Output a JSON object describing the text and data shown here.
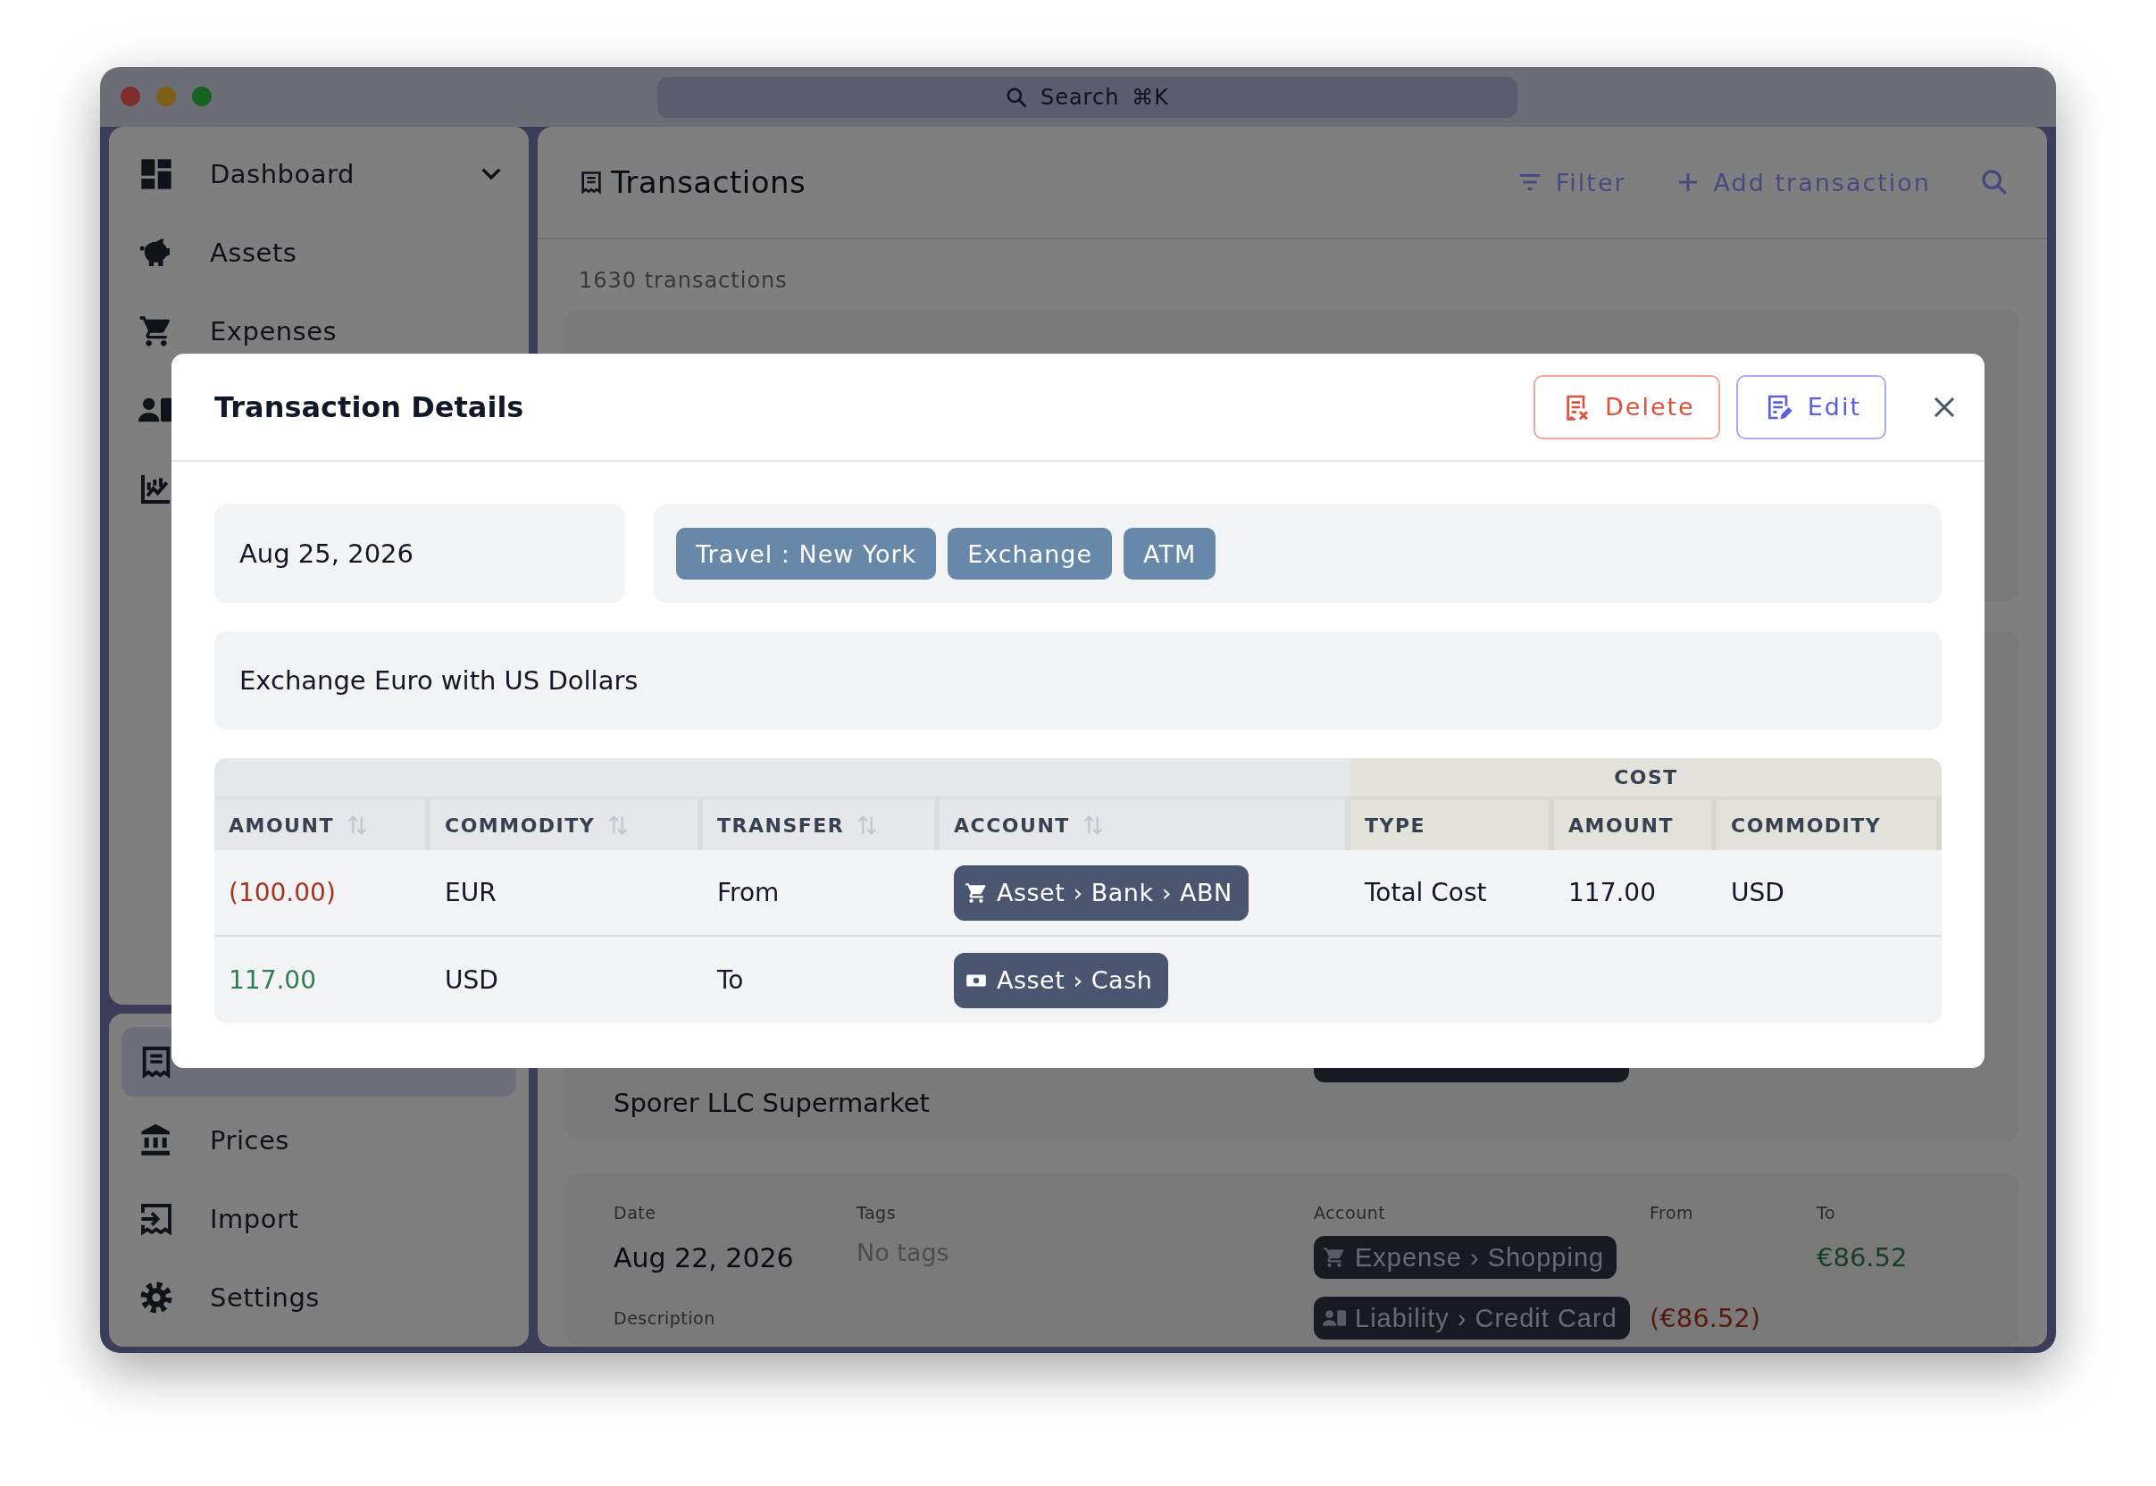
{
  "window": {
    "search": {
      "placeholder": "Search",
      "shortcut": "⌘K"
    }
  },
  "sidebar": {
    "top_items": [
      {
        "label": "Dashboard",
        "selected": false,
        "expandable": true
      },
      {
        "label": "Assets",
        "selected": false
      },
      {
        "label": "Expenses",
        "selected": false
      },
      {
        "selected": false
      },
      {
        "selected": false
      }
    ],
    "bottom_items": [
      {
        "selected": true
      },
      {
        "label": "Prices",
        "selected": false
      },
      {
        "label": "Import",
        "selected": false
      },
      {
        "label": "Settings",
        "selected": false
      }
    ]
  },
  "main": {
    "title": "Transactions",
    "actions": [
      {
        "label": "Filter",
        "kind": "filter"
      },
      {
        "label": "Add transaction",
        "kind": "add"
      }
    ],
    "count": "1630 transactions",
    "card_2": {
      "description": "Sporer LLC Supermarket"
    },
    "card_3": {
      "date_label": "Date",
      "tags_label": "Tags",
      "account_label": "Account",
      "from_label": "From",
      "to_label": "To",
      "description_label": "Description",
      "date": "Aug 22, 2026",
      "tags": "No tags",
      "splits": [
        {
          "kind": "expense",
          "account": "Expense › Shopping",
          "to": "€86.52"
        },
        {
          "kind": "liability",
          "account": "Liability › Credit Card",
          "from": "(€86.52)"
        }
      ]
    }
  },
  "dialog": {
    "title": "Transaction Details",
    "buttons": [
      {
        "label": "Delete",
        "kind": "delete"
      },
      {
        "label": "Edit",
        "kind": "edit"
      }
    ],
    "date": "Aug 25, 2026",
    "tags": [
      {
        "label": "Travel : New York"
      },
      {
        "label": "Exchange"
      },
      {
        "label": "ATM"
      }
    ],
    "description": "Exchange Euro with US Dollars",
    "table": {
      "cost_group": "COST",
      "columns": [
        {
          "label": "AMOUNT",
          "sortable": true,
          "in_cost": false
        },
        {
          "label": "COMMODITY",
          "sortable": true,
          "in_cost": false
        },
        {
          "label": "TRANSFER",
          "sortable": true,
          "in_cost": false
        },
        {
          "label": "ACCOUNT",
          "sortable": true,
          "in_cost": false
        },
        {
          "label": "TYPE",
          "sortable": false,
          "in_cost": true
        },
        {
          "label": "AMOUNT",
          "sortable": false,
          "in_cost": true
        },
        {
          "label": "COMMODITY",
          "sortable": false,
          "in_cost": true
        }
      ],
      "rows": [
        {
          "amount": "(100.00)",
          "color": "#a8321f",
          "commodity": "EUR",
          "transfer": "From",
          "kind": "shop",
          "account": "Asset › Bank › ABN",
          "cost": {
            "type": "Total Cost",
            "amount": "117.00",
            "commodity": "USD"
          }
        },
        {
          "amount": "117.00",
          "color": "#2f7d52",
          "commodity": "USD",
          "transfer": "To",
          "kind": "cash",
          "account": "Asset › Cash"
        }
      ]
    }
  }
}
